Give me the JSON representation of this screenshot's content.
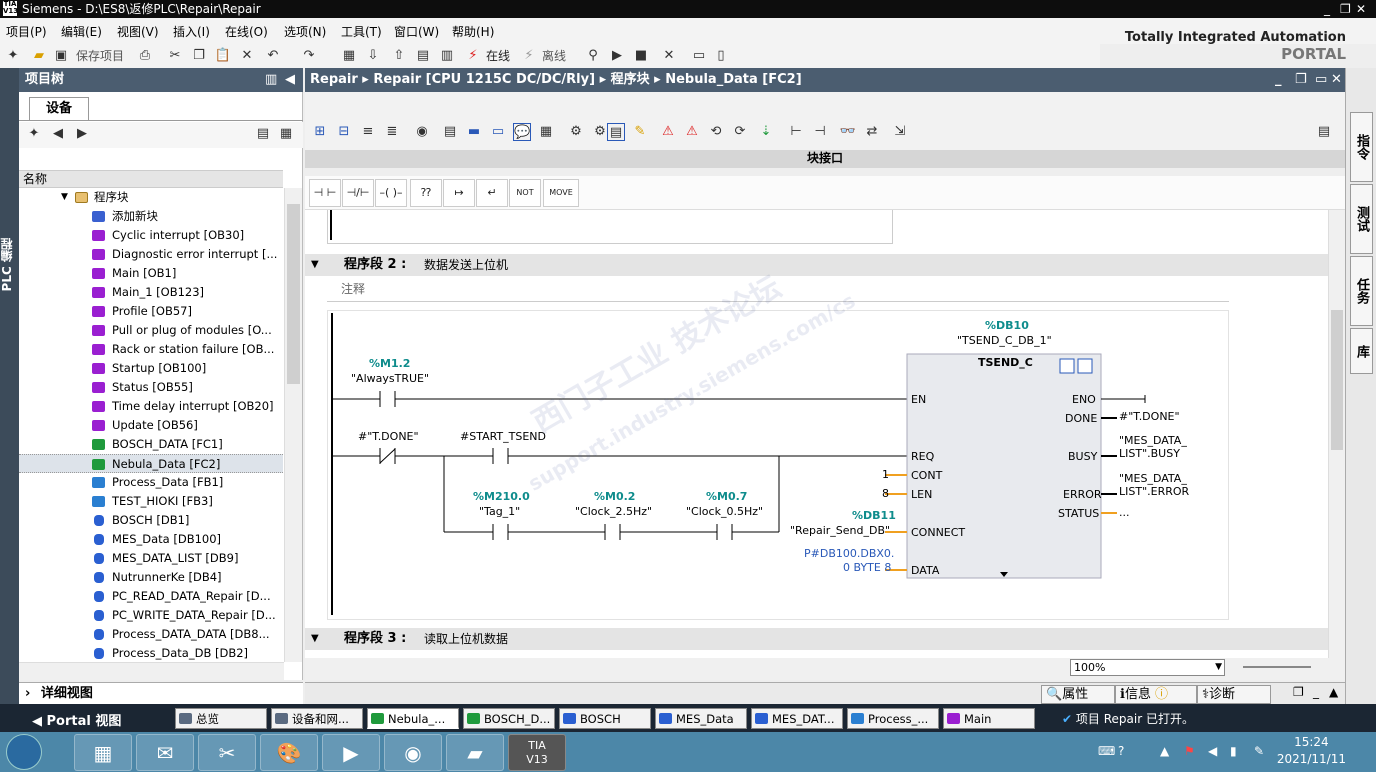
{
  "window": {
    "title": "Siemens  -  D:\\ES8\\返修PLC\\Repair\\Repair",
    "logo_top": "TIA",
    "logo_bottom": "V13",
    "controls": [
      "_",
      "❐",
      "✕"
    ]
  },
  "menu": [
    "项目(P)",
    "编辑(E)",
    "视图(V)",
    "插入(I)",
    "在线(O)",
    "选项(N)",
    "工具(T)",
    "窗口(W)",
    "帮助(H)"
  ],
  "toolbar": {
    "save_project": "保存项目",
    "go_online": "在线",
    "go_offline": "离线"
  },
  "brand": {
    "line1": "Totally Integrated Automation",
    "line2": "PORTAL"
  },
  "left_vertical_tab": "PLC 编程",
  "project_tree": {
    "title": "项目树",
    "tab": "设备",
    "column_name": "名称",
    "root": "程序块",
    "add_new": "添加新块",
    "items": [
      {
        "label": "Cyclic interrupt [OB30]",
        "type": "ob"
      },
      {
        "label": "Diagnostic error interrupt [...",
        "type": "ob"
      },
      {
        "label": "Main [OB1]",
        "type": "ob"
      },
      {
        "label": "Main_1 [OB123]",
        "type": "ob"
      },
      {
        "label": "Profile [OB57]",
        "type": "ob"
      },
      {
        "label": "Pull or plug of modules [O...",
        "type": "ob"
      },
      {
        "label": "Rack or station failure [OB...",
        "type": "ob"
      },
      {
        "label": "Startup [OB100]",
        "type": "ob"
      },
      {
        "label": "Status [OB55]",
        "type": "ob"
      },
      {
        "label": "Time delay interrupt [OB20]",
        "type": "ob"
      },
      {
        "label": "Update [OB56]",
        "type": "ob"
      },
      {
        "label": "BOSCH_DATA [FC1]",
        "type": "fc"
      },
      {
        "label": "Nebula_Data [FC2]",
        "type": "fc"
      },
      {
        "label": "Process_Data [FB1]",
        "type": "fb"
      },
      {
        "label": "TEST_HIOKI [FB3]",
        "type": "fb"
      },
      {
        "label": "BOSCH [DB1]",
        "type": "db"
      },
      {
        "label": "MES_Data [DB100]",
        "type": "db"
      },
      {
        "label": "MES_DATA_LIST [DB9]",
        "type": "db"
      },
      {
        "label": "NutrunnerKe [DB4]",
        "type": "db"
      },
      {
        "label": "PC_READ_DATA_Repair [D...",
        "type": "db"
      },
      {
        "label": "PC_WRITE_DATA_Repair [D...",
        "type": "db"
      },
      {
        "label": "Process_DATA_DATA [DB8...",
        "type": "db"
      },
      {
        "label": "Process_Data_DB [DB2]",
        "type": "db"
      }
    ],
    "selected_index": 12,
    "details_view": "详细视图"
  },
  "editor": {
    "breadcrumb": [
      "Repair",
      "Repair [CPU 1215C DC/DC/Rly]",
      "程序块",
      "Nebula_Data [FC2]"
    ],
    "interface_bar": "块接口",
    "favorites": [
      "⊣ ⊢",
      "⊣/⊢",
      "–( )–",
      "⁇",
      "↦",
      "↵",
      "NOT",
      "MOVE"
    ],
    "network2": {
      "label": "程序段 2 :",
      "title": "数据发送上位机",
      "comment": "注释"
    },
    "network3": {
      "label": "程序段 3 :",
      "title": "读取上位机数据"
    },
    "zoom": "100%"
  },
  "ladder": {
    "instance_db": "%DB10",
    "instance_name": "\"TSEND_C_DB_1\"",
    "block_name": "TSEND_C",
    "contact1_addr": "%M1.2",
    "contact1_name": "\"AlwaysTRUE\"",
    "contact2_name": "#\"T.DONE\"",
    "contact3_name": "#START_TSEND",
    "contact4_addr": "%M210.0",
    "contact4_name": "\"Tag_1\"",
    "contact5_addr": "%M0.2",
    "contact5_name": "\"Clock_2.5Hz\"",
    "contact6_addr": "%M0.7",
    "contact6_name": "\"Clock_0.5Hz\"",
    "pin_en": "EN",
    "pin_req": "REQ",
    "pin_cont": "CONT",
    "pin_len": "LEN",
    "pin_connect": "CONNECT",
    "pin_data": "DATA",
    "pin_eno": "ENO",
    "pin_done": "DONE",
    "pin_busy": "BUSY",
    "pin_error": "ERROR",
    "pin_status": "STATUS",
    "cont_value": "1",
    "len_value": "8",
    "connect_addr": "%DB11",
    "connect_name": "\"Repair_Send_DB\"",
    "data_line1": "P#DB100.DBX0.",
    "data_line2": "0 BYTE 8",
    "done_out": "#\"T.DONE\"",
    "busy_out1": "\"MES_DATA_",
    "busy_out2": "LIST\".BUSY",
    "error_out1": "\"MES_DATA_",
    "error_out2": "LIST\".ERROR",
    "status_out": "..."
  },
  "watermark": {
    "line1": "西门子工业  技术论坛",
    "line2": "support.industry.siemens.com/cs"
  },
  "inspector_tabs": [
    "属性",
    "信息",
    "诊断"
  ],
  "right_tabs": [
    "指令",
    "测试",
    "任务",
    "库"
  ],
  "portal_bar": {
    "portal_view": "Portal 视图",
    "tabs": [
      "总览",
      "设备和网...",
      "Nebula_...",
      "BOSCH_D...",
      "BOSCH",
      "MES_Data",
      "MES_DAT...",
      "Process_...",
      "Main"
    ],
    "status": "项目 Repair 已打开。"
  },
  "taskbar": {
    "time": "15:24",
    "date": "2021/11/11",
    "tia_line1": "TIA",
    "tia_line2": "V13"
  },
  "colors": {
    "header": "#4b5d70",
    "ob_icon": "#9a1fd1",
    "fc_icon": "#1f9a3c",
    "fb_icon": "#2a7fd1",
    "db_icon": "#2a5fd1",
    "teal_address": "#0e8c8c",
    "power_flow_orange": "#f0a020"
  }
}
